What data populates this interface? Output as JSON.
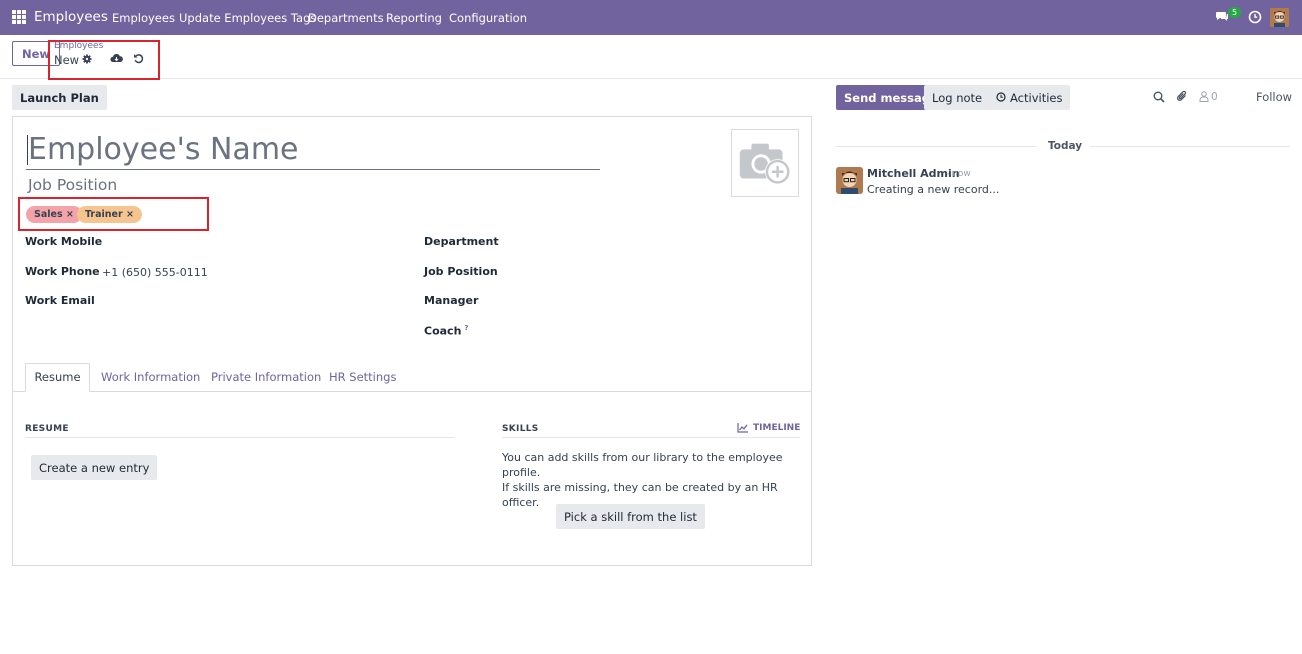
{
  "navbar": {
    "brand": "Employees",
    "menu": [
      "Employees",
      "Update Employees Tags",
      "Departments",
      "Reporting",
      "Configuration"
    ],
    "chat_count": "5",
    "icons": [
      "apps-icon",
      "chat-icon",
      "clock-icon",
      "user-avatar"
    ]
  },
  "control": {
    "new_label": "New",
    "breadcrumb_parent": "Employees",
    "breadcrumb_current": "New",
    "icons": [
      "gear-icon",
      "cloud-save-icon",
      "discard-icon"
    ]
  },
  "actions": {
    "launch_plan": "Launch Plan"
  },
  "form": {
    "name_placeholder": "Employee's Name",
    "job_position_placeholder": "Job Position",
    "tags": [
      "Sales",
      "Trainer"
    ],
    "left_fields": [
      {
        "label": "Work Mobile",
        "value": ""
      },
      {
        "label": "Work Phone",
        "value": "+1 (650) 555-0111"
      },
      {
        "label": "Work Email",
        "value": ""
      }
    ],
    "right_fields": [
      {
        "label": "Department",
        "value": ""
      },
      {
        "label": "Job Position",
        "value": ""
      },
      {
        "label": "Manager",
        "value": ""
      },
      {
        "label": "Coach",
        "value": "",
        "help": "?"
      }
    ],
    "tabs": [
      "Resume",
      "Work Information",
      "Private Information",
      "HR Settings"
    ],
    "active_tab": "Resume",
    "resume": {
      "title": "RESUME",
      "create_entry": "Create a new entry"
    },
    "skills": {
      "title": "SKILLS",
      "timeline": "TIMELINE",
      "text_line1": "You can add skills from our library to the employee profile.",
      "text_line2": "If skills are missing, they can be created by an HR officer.",
      "pick_button": "Pick a skill from the list"
    }
  },
  "chatter": {
    "send_message": "Send message",
    "log_note": "Log note",
    "activities": "Activities",
    "follower_count": "0",
    "follow": "Follow",
    "today": "Today",
    "message": {
      "author": "Mitchell Admin",
      "time": "- now",
      "body": "Creating a new record..."
    }
  },
  "colors": {
    "brand": "#71639e",
    "highlight": "#d9232d",
    "tag_sales": "#f4a4a8",
    "tag_trainer": "#f6c58f"
  }
}
